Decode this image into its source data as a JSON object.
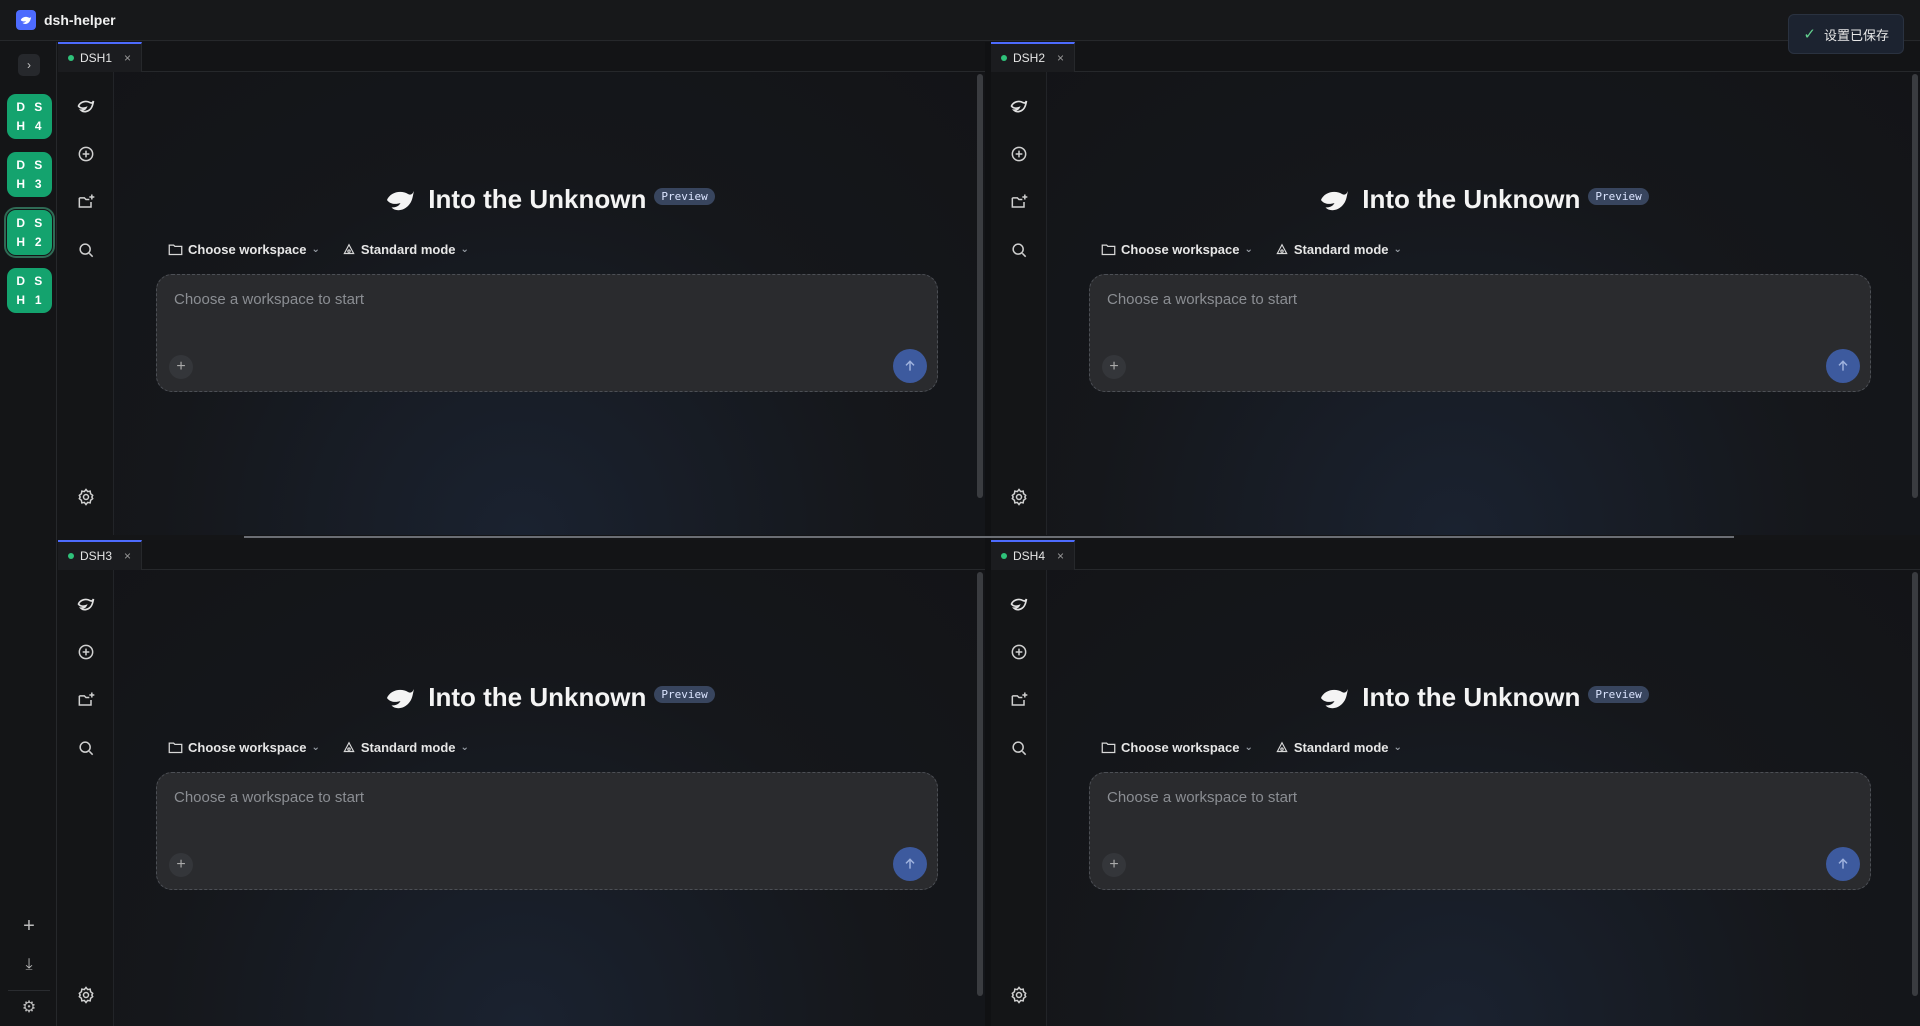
{
  "app": {
    "title": "dsh-helper"
  },
  "toast": {
    "message": "设置已保存"
  },
  "rail": {
    "toggle": "›",
    "sessions": [
      {
        "letters": [
          "D",
          "S",
          "H",
          "4"
        ]
      },
      {
        "letters": [
          "D",
          "S",
          "H",
          "3"
        ]
      },
      {
        "letters": [
          "D",
          "S",
          "H",
          "2"
        ]
      },
      {
        "letters": [
          "D",
          "S",
          "H",
          "1"
        ]
      }
    ],
    "add": "+",
    "download": "⤓",
    "settings": "⚙"
  },
  "panes": [
    {
      "tab": "DSH1",
      "close": "×",
      "hero": "Into the Unknown",
      "badge": "Preview",
      "workspace": "Choose workspace",
      "mode": "Standard mode",
      "placeholder": "Choose a workspace to start"
    },
    {
      "tab": "DSH2",
      "close": "×",
      "hero": "Into the Unknown",
      "badge": "Preview",
      "workspace": "Choose workspace",
      "mode": "Standard mode",
      "placeholder": "Choose a workspace to start"
    },
    {
      "tab": "DSH3",
      "close": "×",
      "hero": "Into the Unknown",
      "badge": "Preview",
      "workspace": "Choose workspace",
      "mode": "Standard mode",
      "placeholder": "Choose a workspace to start"
    },
    {
      "tab": "DSH4",
      "close": "×",
      "hero": "Into the Unknown",
      "badge": "Preview",
      "workspace": "Choose workspace",
      "mode": "Standard mode",
      "placeholder": "Choose a workspace to start"
    }
  ],
  "colors": {
    "accent": "#4d6bfe",
    "session_badge": "#14a36e",
    "status_dot": "#2fc27a"
  }
}
